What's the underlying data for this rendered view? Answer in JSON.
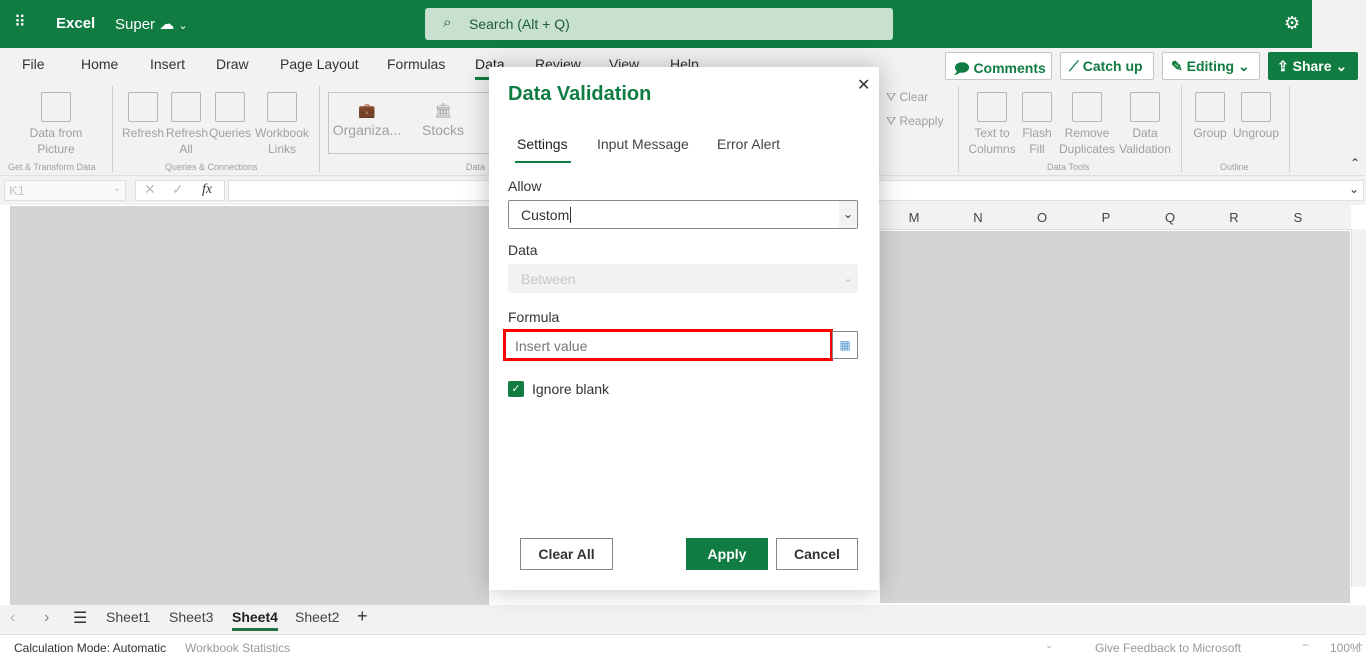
{
  "app": {
    "waffle_icon": "waffle-icon",
    "name": "Excel",
    "doc_name": "Super",
    "search_placeholder": "Search (Alt + Q)",
    "brand_color": "#107c41"
  },
  "menu": [
    "File",
    "Home",
    "Insert",
    "Draw",
    "Page Layout",
    "Formulas",
    "Data",
    "Review",
    "View",
    "Help"
  ],
  "active_menu": "Data",
  "top_buttons": {
    "comments": "Comments",
    "catch_up": "Catch up",
    "editing": "Editing",
    "share": "Share"
  },
  "ribbon": {
    "get_transform": {
      "data_from_picture": "Data from Picture",
      "group": "Get & Transform Data"
    },
    "queries": {
      "refresh": "Refresh",
      "refresh_all": "Refresh All",
      "queries": "Queries",
      "workbook_links": "Workbook Links",
      "group": "Queries & Connections"
    },
    "data_types": {
      "organiza": "Organiza...",
      "stocks": "Stocks",
      "group": "Data"
    },
    "sort_filter": {
      "clear": "Clear",
      "reapply": "Reapply"
    },
    "data_tools": {
      "text_to_columns": "Text to Columns",
      "flash_fill": "Flash Fill",
      "remove_duplicates": "Remove Duplicates",
      "data_validation": "Data Validation",
      "group": "Data Tools"
    },
    "outline": {
      "group_btn": "Group",
      "ungroup": "Ungroup",
      "group": "Outline"
    }
  },
  "formula_bar": {
    "name_box": "K1",
    "fx": "fx"
  },
  "columns": [
    "M",
    "N",
    "O",
    "P",
    "Q",
    "R",
    "S"
  ],
  "sheets": [
    "Sheet1",
    "Sheet3",
    "Sheet4",
    "Sheet2"
  ],
  "active_sheet": "Sheet4",
  "status": {
    "calc_mode": "Calculation Mode: Automatic",
    "workbook_stats": "Workbook Statistics",
    "feedback": "Give Feedback to Microsoft",
    "zoom": "100%"
  },
  "dialog": {
    "title": "Data Validation",
    "tabs": [
      "Settings",
      "Input Message",
      "Error Alert"
    ],
    "active_tab": "Settings",
    "allow_label": "Allow",
    "allow_value": "Custom",
    "data_label": "Data",
    "data_value": "Between",
    "formula_label": "Formula",
    "formula_placeholder": "Insert value",
    "formula_value": "",
    "ignore_blank_label": "Ignore blank",
    "ignore_blank_checked": true,
    "clear_all": "Clear All",
    "apply": "Apply",
    "cancel": "Cancel"
  }
}
